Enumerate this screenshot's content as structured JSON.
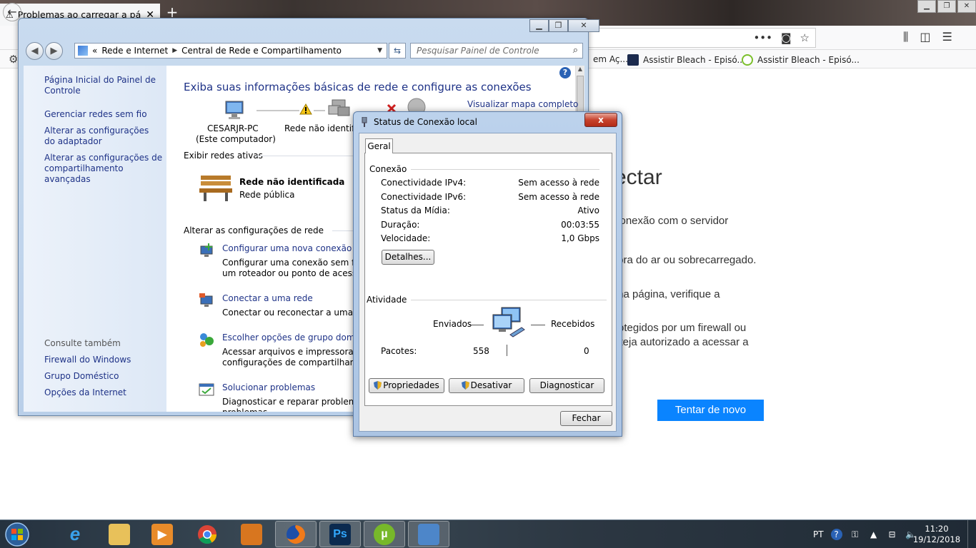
{
  "firefox": {
    "tab_title": "Problemas ao carregar a página",
    "new_tab": "+",
    "bookmarks": [
      {
        "label": "em Aç..."
      },
      {
        "label": "Assistir Bleach - Episó..."
      },
      {
        "label": "Assistir Bleach - Episó..."
      }
    ],
    "error": {
      "title": "ectar",
      "lines": [
        "conexão com o servidor",
        "fora do ar ou sobrecarregado.",
        "ma página, verifique a",
        "rotegidos por um firewall ou",
        "steja autorizado a acessar a"
      ],
      "retry_label": "Tentar de novo"
    }
  },
  "control_panel": {
    "breadcrumb": {
      "lead": "«",
      "items": [
        "Rede e Internet",
        "Central de Rede e Compartilhamento"
      ]
    },
    "search_placeholder": "Pesquisar Painel de Controle",
    "sidebar": {
      "links": [
        "Página Inicial do Painel de Controle",
        "Gerenciar redes sem fio",
        "Alterar as configurações do adaptador",
        "Alterar as configurações de compartilhamento avançadas"
      ],
      "see_also_title": "Consulte também",
      "see_also": [
        "Firewall do Windows",
        "Grupo Doméstico",
        "Opções da Internet"
      ]
    },
    "main": {
      "heading": "Exiba suas informações básicas de rede e configure as conexões",
      "full_map_link": "Visualizar mapa completo",
      "computer_name": "CESARJR-PC",
      "computer_sub": "(Este computador)",
      "network_name_short": "Rede não identific",
      "active_networks_title": "Exibir redes ativas",
      "active_network_name": "Rede não identificada",
      "active_network_type": "Rede pública",
      "change_settings_title": "Alterar as configurações de rede",
      "tasks": [
        {
          "link": "Configurar uma nova conexão ou r",
          "desc": [
            "Configurar uma conexão sem fio, c",
            "um roteador ou ponto de acesso."
          ]
        },
        {
          "link": "Conectar a uma rede",
          "desc": [
            "Conectar ou reconectar a uma con"
          ]
        },
        {
          "link": "Escolher opções de grupo domésti",
          "desc": [
            "Acessar arquivos e impressoras loc",
            "configurações de compartilhamento"
          ]
        },
        {
          "link": "Solucionar problemas",
          "desc": [
            "Diagnosticar e reparar problemas d",
            "problemas"
          ]
        }
      ]
    }
  },
  "status_dialog": {
    "title": "Status de Conexão local",
    "close": "x",
    "tab": "Geral",
    "connection_group": "Conexão",
    "rows": [
      {
        "label": "Conectividade IPv4:",
        "value": "Sem acesso à rede"
      },
      {
        "label": "Conectividade IPv6:",
        "value": "Sem acesso à rede"
      },
      {
        "label": "Status da Mídia:",
        "value": "Ativo"
      },
      {
        "label": "Duração:",
        "value": "00:03:55"
      },
      {
        "label": "Velocidade:",
        "value": "1,0 Gbps"
      }
    ],
    "details_button": "Detalhes...",
    "activity_group": "Atividade",
    "sent_label": "Enviados",
    "received_label": "Recebidos",
    "packets_label": "Pacotes:",
    "packets_sent": "558",
    "packets_received": "0",
    "properties_button": "Propriedades",
    "disable_button": "Desativar",
    "diagnose_button": "Diagnosticar",
    "close_button": "Fechar"
  },
  "taskbar": {
    "language": "PT",
    "time": "11:20",
    "date": "19/12/2018"
  },
  "colors": {
    "link_blue": "#1e3287",
    "firefox_button": "#0a84ff"
  }
}
